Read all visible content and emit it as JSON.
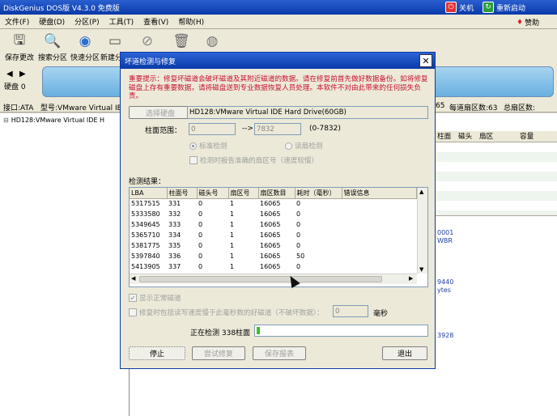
{
  "app": {
    "title": "DiskGenius DOS版 V4.3.0 免费版",
    "shutdown": "关机",
    "restart": "重新启动",
    "help": "赞助"
  },
  "menu": [
    "文件(F)",
    "硬盘(D)",
    "分区(P)",
    "工具(T)",
    "查看(V)",
    "帮助(H)"
  ],
  "toolbar": [
    {
      "label": "保存更改",
      "icon": "save-icon"
    },
    {
      "label": "搜索分区",
      "icon": "search-icon"
    },
    {
      "label": "快速分区",
      "icon": "disk-icon"
    },
    {
      "label": "新建分区",
      "icon": "new-partition-icon"
    },
    {
      "label": "",
      "icon": "no-icon"
    },
    {
      "label": "",
      "icon": "trash-icon"
    },
    {
      "label": "",
      "icon": "backup-icon"
    }
  ],
  "diskbar": {
    "label": "硬盘 0"
  },
  "infobar": {
    "iface": "接口:ATA",
    "model": "型号:VMware Virtual IE",
    "sectors_per_track_num": "65",
    "sectors_per_track": "每道扇区数:63",
    "total_sectors": "总扇区数:"
  },
  "tree": {
    "item": "HD128:VMware Virtual IDE H"
  },
  "right": {
    "headers": [
      "柱面",
      "磁头",
      "扇区",
      "容量"
    ],
    "snips": [
      "0001",
      "WBR",
      "9440",
      "ytes",
      "3928"
    ]
  },
  "dialog": {
    "title": "坏道检测与修复",
    "warning": "重要提示：修复坏磁道会破坏磁道及其附近磁道的数据。请在修复前首先做好数据备份。如将修复磁盘上存有重要数据，请将磁盘送到专业数据恢复人员处理。本软件不对由此带来的任何损失负责。",
    "select_disk": "选择硬盘",
    "disk_name": "HD128:VMware Virtual IDE Hard Drive(60GB)",
    "cyl_range_label": "柱面范围：",
    "cyl_from": "0",
    "cyl_arrow": "-->",
    "cyl_to": "7832",
    "cyl_hint": "(0-7832)",
    "radio_std": "标准检测",
    "radio_read": "读扇检测",
    "chk_report": "检测时报告准确的扇区号（速度较慢）",
    "results_label": "检测结果：",
    "columns": [
      "LBA",
      "柱面号",
      "磁头号",
      "扇区号",
      "扇区数目",
      "耗时（毫秒）",
      "错误信息"
    ],
    "rows": [
      [
        "5317515",
        "331",
        "0",
        "1",
        "16065",
        "0",
        ""
      ],
      [
        "5333580",
        "332",
        "0",
        "1",
        "16065",
        "0",
        ""
      ],
      [
        "5349645",
        "333",
        "0",
        "1",
        "16065",
        "0",
        ""
      ],
      [
        "5365710",
        "334",
        "0",
        "1",
        "16065",
        "0",
        ""
      ],
      [
        "5381775",
        "335",
        "0",
        "1",
        "16065",
        "0",
        ""
      ],
      [
        "5397840",
        "336",
        "0",
        "1",
        "16065",
        "50",
        ""
      ],
      [
        "5413905",
        "337",
        "0",
        "1",
        "16065",
        "0",
        ""
      ]
    ],
    "chk_show_normal": "显示正常磁道",
    "chk_repair_slow": "修复时包括读写速度慢于此毫秒数的好磁道（不破坏数据）：",
    "ms_value": "0",
    "ms_label": "毫秒",
    "status_text": "正在检测 338柱面",
    "progress": 0.02,
    "btn_stop": "停止",
    "btn_try_repair": "尝试修复",
    "btn_save_report": "保存报表",
    "btn_exit": "退出"
  }
}
